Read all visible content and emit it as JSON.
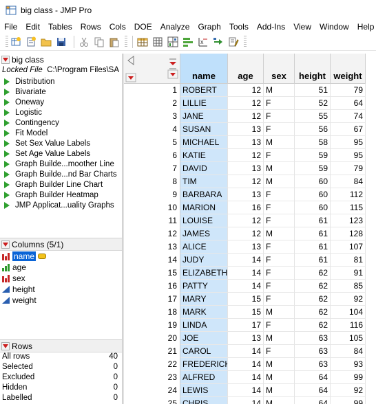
{
  "window": {
    "title": "big class - JMP Pro"
  },
  "menu": [
    "File",
    "Edit",
    "Tables",
    "Rows",
    "Cols",
    "DOE",
    "Analyze",
    "Graph",
    "Tools",
    "Add-Ins",
    "View",
    "Window",
    "Help"
  ],
  "toolbar": {
    "icons": [
      "new-data-table-icon",
      "new-script-icon",
      "open-file-icon",
      "save-icon",
      "cut-icon",
      "copy-icon",
      "paste-icon",
      "data-grid-icon",
      "tabulate-icon",
      "graph-builder-icon",
      "distribution-icon",
      "fit-y-by-x-icon",
      "fit-model-icon",
      "script-editor-icon"
    ]
  },
  "table_panel": {
    "name": "big class",
    "locked_label": "Locked File",
    "locked_path": "C:\\Program Files\\SA",
    "scripts": [
      "Distribution",
      "Bivariate",
      "Oneway",
      "Logistic",
      "Contingency",
      "Fit Model",
      "Set Sex Value Labels",
      "Set Age Value Labels",
      "Graph Builde...moother Line",
      "Graph Builde...nd Bar Charts",
      "Graph Builder Line Chart",
      "Graph Builder Heatmap",
      "JMP Applicat...uality Graphs"
    ]
  },
  "columns_panel": {
    "header": "Columns (5/1)",
    "items": [
      {
        "name": "name",
        "modeling": "nominal",
        "selected": true,
        "key": true
      },
      {
        "name": "age",
        "modeling": "ordinal",
        "selected": false,
        "key": false
      },
      {
        "name": "sex",
        "modeling": "nominal",
        "selected": false,
        "key": false
      },
      {
        "name": "height",
        "modeling": "continuous",
        "selected": false,
        "key": false
      },
      {
        "name": "weight",
        "modeling": "continuous",
        "selected": false,
        "key": false
      }
    ]
  },
  "rows_panel": {
    "header": "Rows",
    "stats": [
      {
        "label": "All rows",
        "value": "40"
      },
      {
        "label": "Selected",
        "value": "0"
      },
      {
        "label": "Excluded",
        "value": "0"
      },
      {
        "label": "Hidden",
        "value": "0"
      },
      {
        "label": "Labelled",
        "value": "0"
      }
    ]
  },
  "grid": {
    "columns": [
      "name",
      "age",
      "sex",
      "height",
      "weight"
    ],
    "rows": [
      [
        "1",
        "ROBERT",
        "12",
        "M",
        "51",
        "79"
      ],
      [
        "2",
        "LILLIE",
        "12",
        "F",
        "52",
        "64"
      ],
      [
        "3",
        "JANE",
        "12",
        "F",
        "55",
        "74"
      ],
      [
        "4",
        "SUSAN",
        "13",
        "F",
        "56",
        "67"
      ],
      [
        "5",
        "MICHAEL",
        "13",
        "M",
        "58",
        "95"
      ],
      [
        "6",
        "KATIE",
        "12",
        "F",
        "59",
        "95"
      ],
      [
        "7",
        "DAVID",
        "13",
        "M",
        "59",
        "79"
      ],
      [
        "8",
        "TIM",
        "12",
        "M",
        "60",
        "84"
      ],
      [
        "9",
        "BARBARA",
        "13",
        "F",
        "60",
        "112"
      ],
      [
        "10",
        "MARION",
        "16",
        "F",
        "60",
        "115"
      ],
      [
        "11",
        "LOUISE",
        "12",
        "F",
        "61",
        "123"
      ],
      [
        "12",
        "JAMES",
        "12",
        "M",
        "61",
        "128"
      ],
      [
        "13",
        "ALICE",
        "13",
        "F",
        "61",
        "107"
      ],
      [
        "14",
        "JUDY",
        "14",
        "F",
        "61",
        "81"
      ],
      [
        "15",
        "ELIZABETH",
        "14",
        "F",
        "62",
        "91"
      ],
      [
        "16",
        "PATTY",
        "14",
        "F",
        "62",
        "85"
      ],
      [
        "17",
        "MARY",
        "15",
        "F",
        "62",
        "92"
      ],
      [
        "18",
        "MARK",
        "15",
        "M",
        "62",
        "104"
      ],
      [
        "19",
        "LINDA",
        "17",
        "F",
        "62",
        "116"
      ],
      [
        "20",
        "JOE",
        "13",
        "M",
        "63",
        "105"
      ],
      [
        "21",
        "CAROL",
        "14",
        "F",
        "63",
        "84"
      ],
      [
        "22",
        "FREDERICK",
        "14",
        "M",
        "63",
        "93"
      ],
      [
        "23",
        "ALFRED",
        "14",
        "M",
        "64",
        "99"
      ],
      [
        "24",
        "LEWIS",
        "14",
        "M",
        "64",
        "92"
      ],
      [
        "25",
        "CHRIS",
        "14",
        "M",
        "64",
        "99"
      ]
    ]
  }
}
